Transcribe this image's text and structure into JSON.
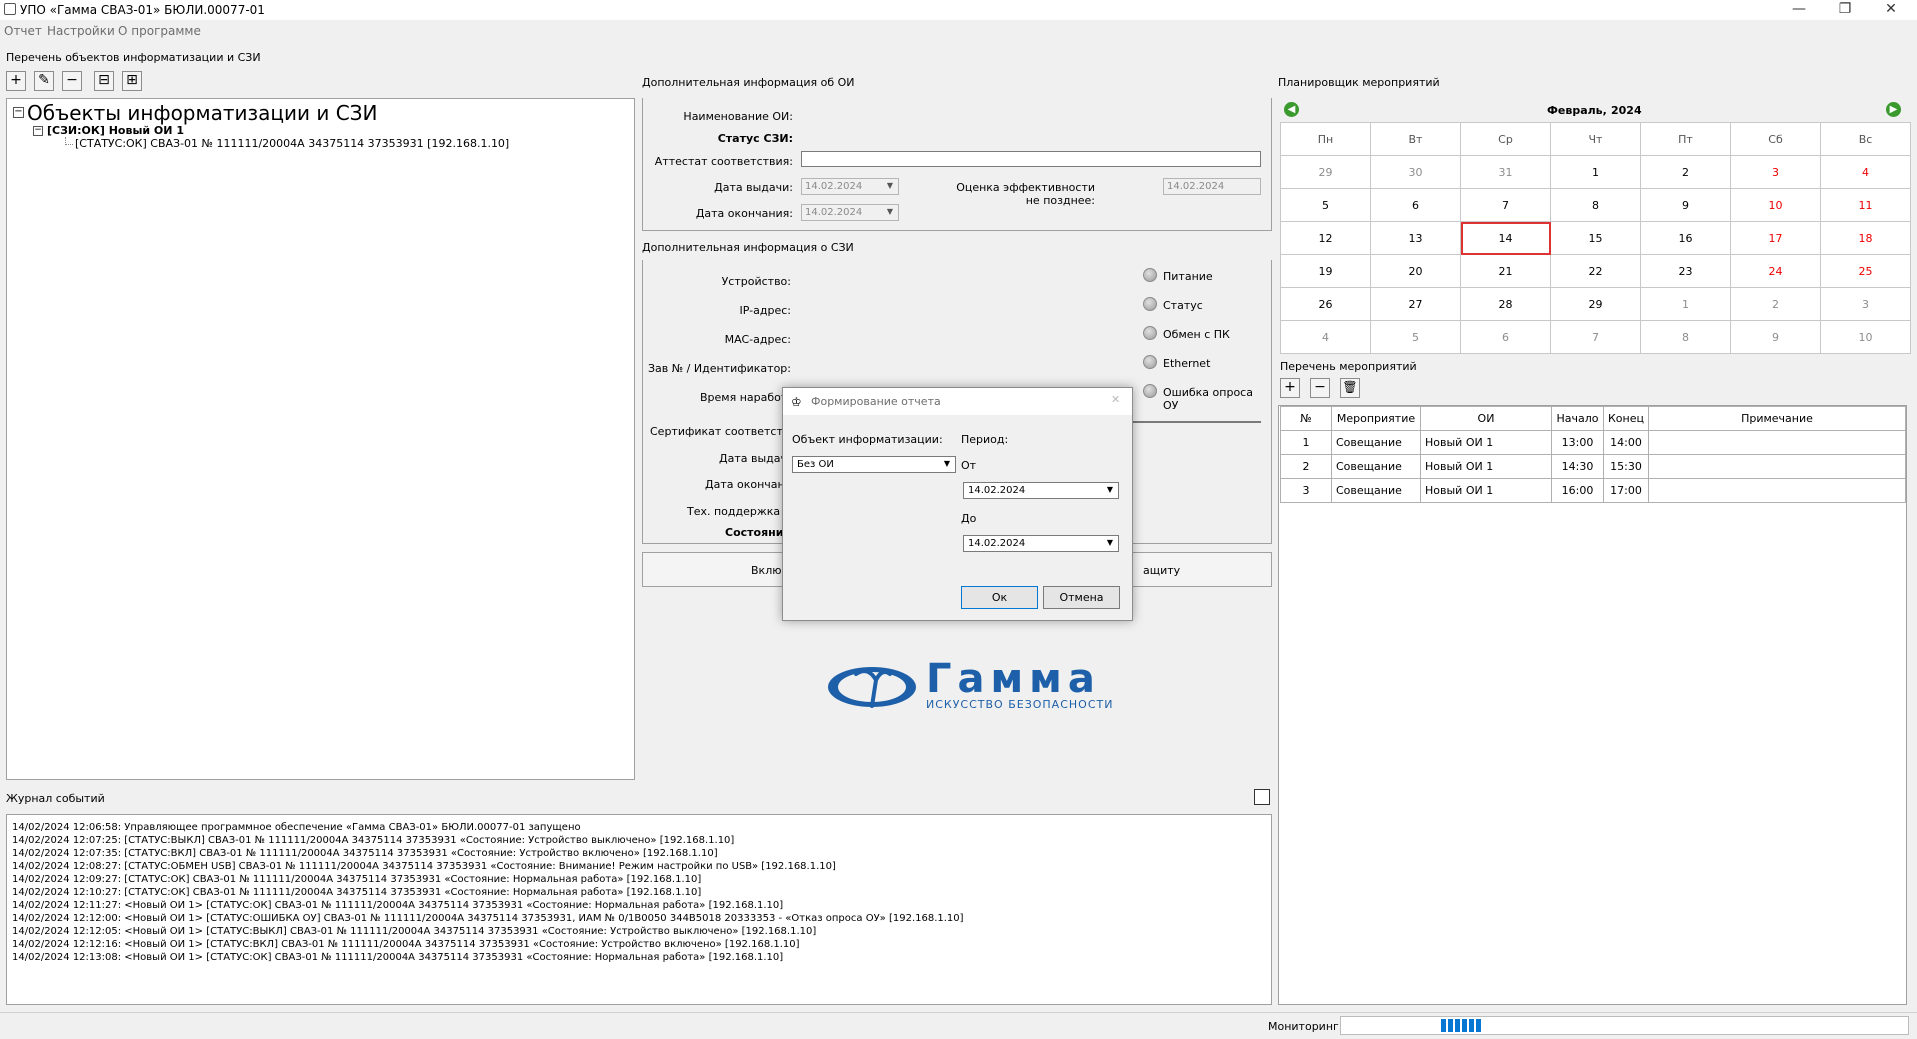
{
  "window": {
    "title": "УПО «Гамма СВАЗ-01» БЮЛИ.00077-01"
  },
  "menu": [
    "Отчет",
    "Настройки",
    "О программе"
  ],
  "left": {
    "title": "Перечень объектов информатизации и СЗИ",
    "tree_root": "Объекты информатизации и СЗИ",
    "tree_oi": "[СЗИ:ОК] Новый ОИ 1",
    "tree_device": "[СТАТУС:ОК] СВАЗ-01 № 111111/20004А 34375114 37353931 [192.168.1.10]"
  },
  "oi_info": {
    "title": "Дополнительная информация об ОИ",
    "name_label": "Наименование ОИ:",
    "status_label": "Статус СЗИ:",
    "attest_label": "Аттестат соответствия:",
    "issue_label": "Дата выдачи:",
    "issue_value": "14.02.2024",
    "end_label": "Дата окончания:",
    "end_value": "14.02.2024",
    "eff_label": "Оценка эффективности не позднее:",
    "eff_value": "14.02.2024"
  },
  "szi_info": {
    "title": "Дополнительная информация о СЗИ",
    "device_label": "Устройство:",
    "ip_label": "IP-адрес:",
    "mac_label": "MAC-адрес:",
    "serial_label": "Зав № / Идентификатор:",
    "uptime_label": "Время наработк",
    "cert_label": "Сертификат соответстви",
    "issue_label": "Дата выдач",
    "end_label": "Дата окончани",
    "support_label": "Тех. поддержка д",
    "state_label": "Состояни",
    "indicators": [
      "Питание",
      "Статус",
      "Обмен с ПК",
      "Ethernet",
      "Ошибка опроса ОУ"
    ],
    "btn_left": "Включ",
    "btn_right": "ащиту"
  },
  "logo": {
    "name": "Гамма",
    "tagline": "ИСКУССТВО БЕЗОПАСНОСТИ"
  },
  "planner": {
    "title": "Планировщик мероприятий",
    "month": "Февраль,",
    "year": "2024",
    "weekdays": [
      "Пн",
      "Вт",
      "Ср",
      "Чт",
      "Пт",
      "Сб",
      "Вс"
    ],
    "weeks": [
      [
        "29",
        "30",
        "31",
        "1",
        "2",
        "3",
        "4"
      ],
      [
        "5",
        "6",
        "7",
        "8",
        "9",
        "10",
        "11"
      ],
      [
        "12",
        "13",
        "14",
        "15",
        "16",
        "17",
        "18"
      ],
      [
        "19",
        "20",
        "21",
        "22",
        "23",
        "24",
        "25"
      ],
      [
        "26",
        "27",
        "28",
        "29",
        "1",
        "2",
        "3"
      ],
      [
        "4",
        "5",
        "6",
        "7",
        "8",
        "9",
        "10"
      ]
    ],
    "selected": "14",
    "events_title": "Перечень мероприятий",
    "events_headers": [
      "№",
      "Мероприятие",
      "ОИ",
      "Начало",
      "Конец",
      "Примечание"
    ],
    "events": [
      [
        "1",
        "Совещание",
        "Новый ОИ 1",
        "13:00",
        "14:00",
        ""
      ],
      [
        "2",
        "Совещание",
        "Новый ОИ 1",
        "14:30",
        "15:30",
        ""
      ],
      [
        "3",
        "Совещание",
        "Новый ОИ 1",
        "16:00",
        "17:00",
        ""
      ]
    ]
  },
  "log": {
    "title": "Журнал событий",
    "lines": [
      "14/02/2024 12:06:58: Управляющее программное обеспечение «Гамма СВАЗ-01» БЮЛИ.00077-01 запущено",
      "14/02/2024 12:07:25: [СТАТУС:ВЫКЛ] СВАЗ-01 № 111111/20004А 34375114 37353931 «Состояние: Устройство выключено» [192.168.1.10]",
      "14/02/2024 12:07:35: [СТАТУС:ВКЛ] СВАЗ-01 № 111111/20004А 34375114 37353931 «Состояние: Устройство включено» [192.168.1.10]",
      "14/02/2024 12:08:27: [СТАТУС:ОБМЕН USB] СВАЗ-01 № 111111/20004А 34375114 37353931 «Состояние: Внимание! Режим настройки по USB» [192.168.1.10]",
      "14/02/2024 12:09:27: [СТАТУС:ОК] СВАЗ-01 № 111111/20004А 34375114 37353931 «Состояние: Нормальная работа» [192.168.1.10]",
      "14/02/2024 12:10:27: [СТАТУС:ОК] СВАЗ-01 № 111111/20004А 34375114 37353931 «Состояние: Нормальная работа» [192.168.1.10]",
      "14/02/2024 12:11:27: <Новый ОИ 1> [СТАТУС:ОК] СВАЗ-01 № 111111/20004А 34375114 37353931 «Состояние: Нормальная работа» [192.168.1.10]",
      "14/02/2024 12:12:00: <Новый ОИ 1> [СТАТУС:ОШИБКА ОУ] СВАЗ-01 № 111111/20004А 34375114 37353931, ИАМ № 0/1В0050 344В5018 20333353   - «Отказ опроса ОУ» [192.168.1.10]",
      "14/02/2024 12:12:05: <Новый ОИ 1> [СТАТУС:ВЫКЛ] СВАЗ-01 № 111111/20004А 34375114 37353931 «Состояние: Устройство выключено» [192.168.1.10]",
      "14/02/2024 12:12:16: <Новый ОИ 1> [СТАТУС:ВКЛ] СВАЗ-01 № 111111/20004А 34375114 37353931 «Состояние: Устройство включено» [192.168.1.10]",
      "14/02/2024 12:13:08: <Новый ОИ 1> [СТАТУС:ОК] СВАЗ-01 № 111111/20004А 34375114 37353931 «Состояние: Нормальная работа» [192.168.1.10]"
    ]
  },
  "status": {
    "monitoring_label": "Мониторинг:"
  },
  "dialog": {
    "title": "Формирование отчета",
    "object_label": "Объект информатизации:",
    "object_value": "Без ОИ",
    "period_label": "Период:",
    "from_label": "От",
    "from_value": "14.02.2024",
    "to_label": "До",
    "to_value": "14.02.2024",
    "ok": "Ок",
    "cancel": "Отмена"
  }
}
